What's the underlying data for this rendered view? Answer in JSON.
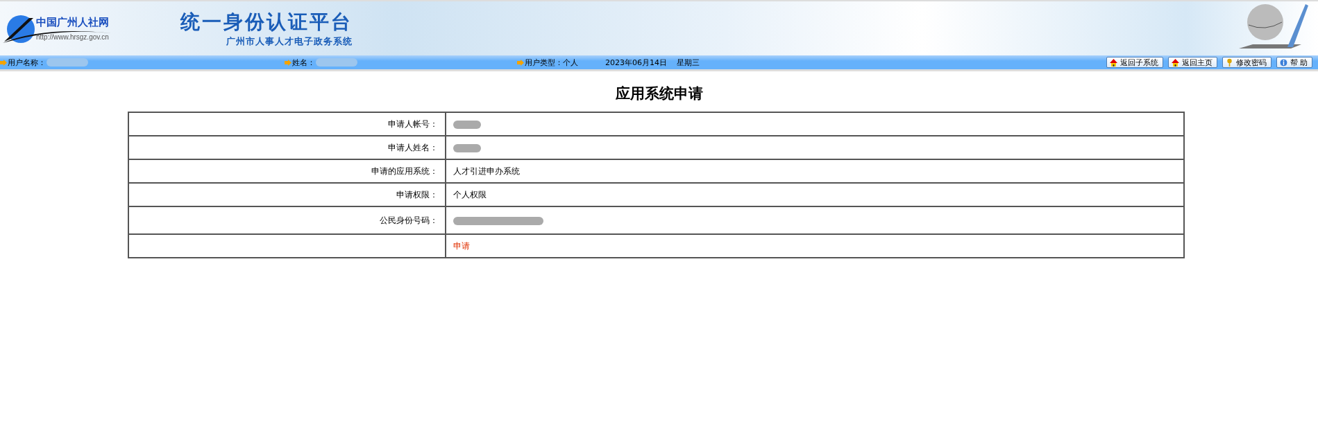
{
  "header": {
    "logo_text": "中国广州人社网",
    "logo_url": "http://www.hrsgz.gov.cn",
    "title": "统一身份认证平台",
    "subtitle": "广州市人事人才电子政务系统"
  },
  "info_bar": {
    "items": [
      {
        "label": "用户名称：",
        "redacted": true
      },
      {
        "label": "姓名：",
        "redacted": true
      },
      {
        "label": "用户类型：个人",
        "redacted": false
      }
    ],
    "date": "2023年06月14日",
    "weekday": "星期三",
    "buttons": [
      {
        "label": "返回子系统",
        "kind": "house"
      },
      {
        "label": "返回主页",
        "kind": "house"
      },
      {
        "label": "修改密码",
        "kind": "key"
      },
      {
        "label": "帮 助",
        "kind": "help"
      }
    ]
  },
  "page_title": "应用系统申请",
  "form": {
    "rows": [
      {
        "label": "申请人帐号：",
        "kind": "redacted"
      },
      {
        "label": "申请人姓名：",
        "kind": "redacted"
      },
      {
        "label": "申请的应用系统：",
        "kind": "text",
        "value": "人才引进申办系统"
      },
      {
        "label": "申请权限：",
        "kind": "text",
        "value": "个人权限"
      },
      {
        "label": "公民身份号码：",
        "kind": "redacted_wide"
      },
      {
        "kind": "action",
        "value": "申请"
      }
    ]
  }
}
